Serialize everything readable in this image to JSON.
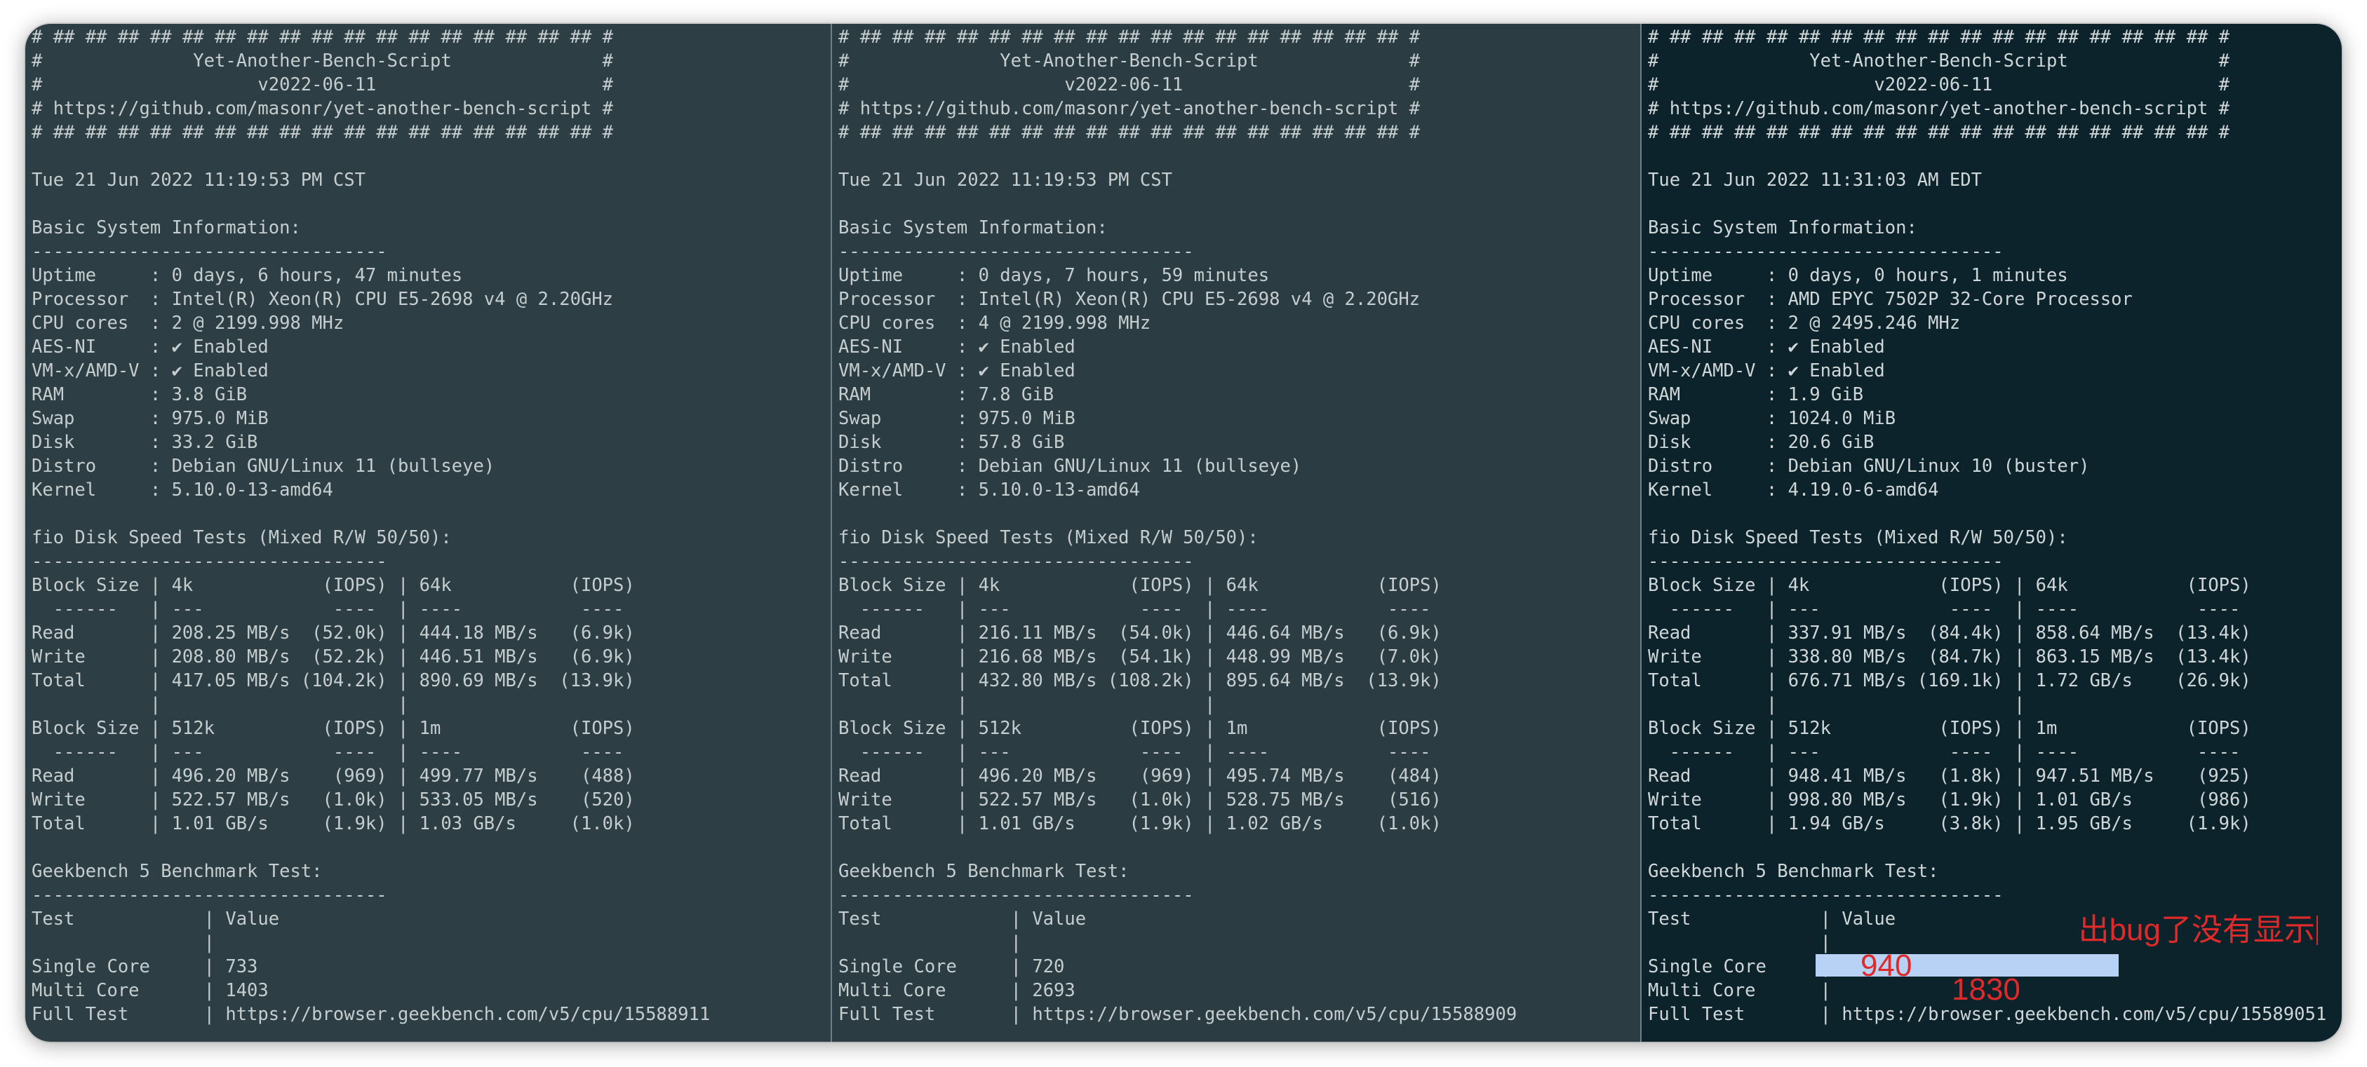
{
  "panes": [
    {
      "id": "server-1",
      "lines": [
        "# ## ## ## ## ## ## ## ## ## ## ## ## ## ## ## ## ## #",
        "#              Yet-Another-Bench-Script              #",
        "#                    v2022-06-11                     #",
        "# https://github.com/masonr/yet-another-bench-script #",
        "# ## ## ## ## ## ## ## ## ## ## ## ## ## ## ## ## ## #",
        "",
        "Tue 21 Jun 2022 11:19:53 PM CST",
        "",
        "Basic System Information:",
        "---------------------------------",
        "Uptime     : 0 days, 6 hours, 47 minutes",
        "Processor  : Intel(R) Xeon(R) CPU E5-2698 v4 @ 2.20GHz",
        "CPU cores  : 2 @ 2199.998 MHz",
        "AES-NI     : ✔ Enabled",
        "VM-x/AMD-V : ✔ Enabled",
        "RAM        : 3.8 GiB",
        "Swap       : 975.0 MiB",
        "Disk       : 33.2 GiB",
        "Distro     : Debian GNU/Linux 11 (bullseye)",
        "Kernel     : 5.10.0-13-amd64",
        "",
        "fio Disk Speed Tests (Mixed R/W 50/50):",
        "---------------------------------",
        "Block Size | 4k            (IOPS) | 64k           (IOPS)",
        "  ------   | ---            ----  | ----           ----",
        "Read       | 208.25 MB/s  (52.0k) | 444.18 MB/s   (6.9k)",
        "Write      | 208.80 MB/s  (52.2k) | 446.51 MB/s   (6.9k)",
        "Total      | 417.05 MB/s (104.2k) | 890.69 MB/s  (13.9k)",
        "           |                      |",
        "Block Size | 512k          (IOPS) | 1m            (IOPS)",
        "  ------   | ---            ----  | ----           ----",
        "Read       | 496.20 MB/s    (969) | 499.77 MB/s    (488)",
        "Write      | 522.57 MB/s   (1.0k) | 533.05 MB/s    (520)",
        "Total      | 1.01 GB/s     (1.9k) | 1.03 GB/s     (1.0k)",
        "",
        "Geekbench 5 Benchmark Test:",
        "---------------------------------",
        "Test            | Value",
        "                |",
        "Single Core     | 733",
        "Multi Core      | 1403",
        "Full Test       | https://browser.geekbench.com/v5/cpu/15588911"
      ]
    },
    {
      "id": "server-2",
      "lines": [
        "# ## ## ## ## ## ## ## ## ## ## ## ## ## ## ## ## ## #",
        "#              Yet-Another-Bench-Script              #",
        "#                    v2022-06-11                     #",
        "# https://github.com/masonr/yet-another-bench-script #",
        "# ## ## ## ## ## ## ## ## ## ## ## ## ## ## ## ## ## #",
        "",
        "Tue 21 Jun 2022 11:19:53 PM CST",
        "",
        "Basic System Information:",
        "---------------------------------",
        "Uptime     : 0 days, 7 hours, 59 minutes",
        "Processor  : Intel(R) Xeon(R) CPU E5-2698 v4 @ 2.20GHz",
        "CPU cores  : 4 @ 2199.998 MHz",
        "AES-NI     : ✔ Enabled",
        "VM-x/AMD-V : ✔ Enabled",
        "RAM        : 7.8 GiB",
        "Swap       : 975.0 MiB",
        "Disk       : 57.8 GiB",
        "Distro     : Debian GNU/Linux 11 (bullseye)",
        "Kernel     : 5.10.0-13-amd64",
        "",
        "fio Disk Speed Tests (Mixed R/W 50/50):",
        "---------------------------------",
        "Block Size | 4k            (IOPS) | 64k           (IOPS)",
        "  ------   | ---            ----  | ----           ----",
        "Read       | 216.11 MB/s  (54.0k) | 446.64 MB/s   (6.9k)",
        "Write      | 216.68 MB/s  (54.1k) | 448.99 MB/s   (7.0k)",
        "Total      | 432.80 MB/s (108.2k) | 895.64 MB/s  (13.9k)",
        "           |                      |",
        "Block Size | 512k          (IOPS) | 1m            (IOPS)",
        "  ------   | ---            ----  | ----           ----",
        "Read       | 496.20 MB/s    (969) | 495.74 MB/s    (484)",
        "Write      | 522.57 MB/s   (1.0k) | 528.75 MB/s    (516)",
        "Total      | 1.01 GB/s     (1.9k) | 1.02 GB/s     (1.0k)",
        "",
        "Geekbench 5 Benchmark Test:",
        "---------------------------------",
        "Test            | Value",
        "                |",
        "Single Core     | 720",
        "Multi Core      | 2693",
        "Full Test       | https://browser.geekbench.com/v5/cpu/15588909"
      ]
    },
    {
      "id": "server-3",
      "lines": [
        "# ## ## ## ## ## ## ## ## ## ## ## ## ## ## ## ## ## #",
        "#              Yet-Another-Bench-Script              #",
        "#                    v2022-06-11                     #",
        "# https://github.com/masonr/yet-another-bench-script #",
        "# ## ## ## ## ## ## ## ## ## ## ## ## ## ## ## ## ## #",
        "",
        "Tue 21 Jun 2022 11:31:03 AM EDT",
        "",
        "Basic System Information:",
        "---------------------------------",
        "Uptime     : 0 days, 0 hours, 1 minutes",
        "Processor  : AMD EPYC 7502P 32-Core Processor",
        "CPU cores  : 2 @ 2495.246 MHz",
        "AES-NI     : ✔ Enabled",
        "VM-x/AMD-V : ✔ Enabled",
        "RAM        : 1.9 GiB",
        "Swap       : 1024.0 MiB",
        "Disk       : 20.6 GiB",
        "Distro     : Debian GNU/Linux 10 (buster)",
        "Kernel     : 4.19.0-6-amd64",
        "",
        "fio Disk Speed Tests (Mixed R/W 50/50):",
        "---------------------------------",
        "Block Size | 4k            (IOPS) | 64k           (IOPS)",
        "  ------   | ---            ----  | ----           ----",
        "Read       | 337.91 MB/s  (84.4k) | 858.64 MB/s  (13.4k)",
        "Write      | 338.80 MB/s  (84.7k) | 863.15 MB/s  (13.4k)",
        "Total      | 676.71 MB/s (169.1k) | 1.72 GB/s    (26.9k)",
        "           |                      |",
        "Block Size | 512k          (IOPS) | 1m            (IOPS)",
        "  ------   | ---            ----  | ----           ----",
        "Read       | 948.41 MB/s   (1.8k) | 947.51 MB/s    (925)",
        "Write      | 998.80 MB/s   (1.9k) | 1.01 GB/s      (986)",
        "Total      | 1.94 GB/s     (3.8k) | 1.95 GB/s     (1.9k)",
        "",
        "Geekbench 5 Benchmark Test:",
        "---------------------------------",
        "Test            | Value",
        "                |",
        "Single Core     |",
        "Multi Core      |",
        "Full Test       | https://browser.geekbench.com/v5/cpu/15589051"
      ]
    }
  ],
  "annotations": {
    "single_core_value": "940",
    "multi_core_value": "1830",
    "note": "出bug了没有显示",
    "highlight_color": "#b7d2f4",
    "ink_color": "#e02a2a"
  }
}
